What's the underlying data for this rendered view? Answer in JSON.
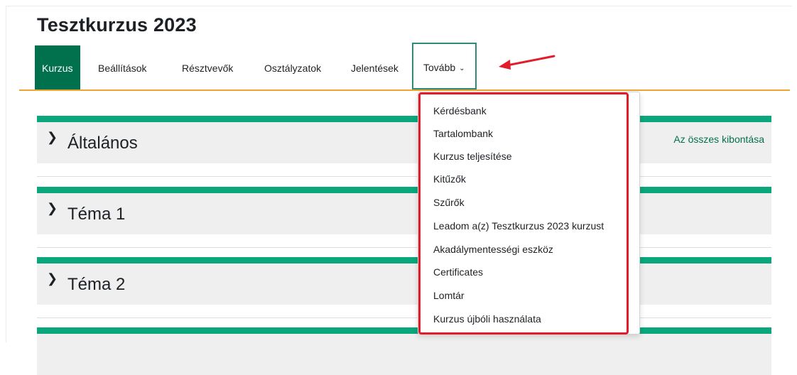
{
  "course": {
    "title": "Tesztkurzus 2023"
  },
  "nav": {
    "items": [
      "Kurzus",
      "Beállítások",
      "Résztvevők",
      "Osztályzatok",
      "Jelentések"
    ],
    "more_label": "Tovább"
  },
  "sections": {
    "expand_all": "Az összes kibontása",
    "items": [
      "Általános",
      "Téma 1",
      "Téma 2"
    ]
  },
  "menu": {
    "items": [
      "Kérdésbank",
      "Tartalombank",
      "Kurzus teljesítése",
      "Kitűzők",
      "Szűrők",
      "Leadom a(z) Tesztkurzus 2023 kurzust",
      "Akadálymentességi eszköz",
      "Certificates",
      "Lomtár",
      "Kurzus újbóli használata"
    ]
  },
  "icons": [
    "chevron-down-icon",
    "section-expand-icon",
    "red-arrow-annotation"
  ],
  "colors": {
    "accent_green": "#00704d",
    "section_green": "#0aa67c",
    "nav_underline": "#f0a42e",
    "highlight_red": "#e11d2c"
  }
}
